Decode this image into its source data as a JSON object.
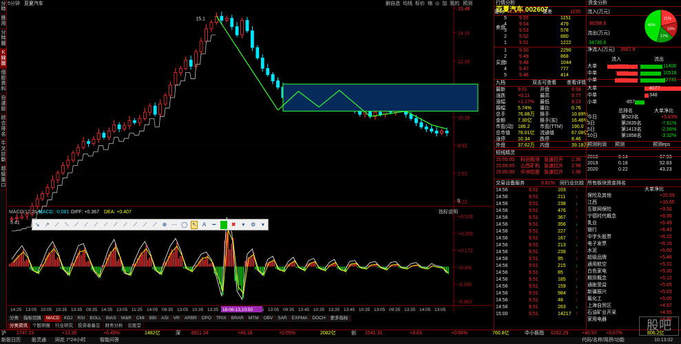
{
  "left_tabs": [
    "分時",
    "應用",
    "分時圖",
    "K線圖",
    "個股資料",
    "自選股",
    "綜合排名",
    "牛叉診斷",
    "超級盤口"
  ],
  "header": {
    "period": "5分钟",
    "name": "亚夏汽车",
    "menu": [
      "删自选",
      "均线",
      "标价",
      "缩",
      "◎",
      "加",
      "我的"
    ],
    "menu_extra": "预测"
  },
  "price_axis": [
    "15.48",
    "14.31",
    "12.95",
    "11.65",
    "10.26",
    "8.92",
    "7.57",
    "6.22"
  ],
  "annotations": {
    "high": "15.1",
    "low": "5.41",
    "marker": "q"
  },
  "macd_header": {
    "name": "MACD(12,26,9)",
    "macd_label": "MACD: -0.081",
    "diff_label": "DIFF: +0.367",
    "dea_label": "DEA: +0.407",
    "hint": "指标说明"
  },
  "macd_axis": [
    "+0.528",
    "+0.350",
    "+0.172",
    "-0.006",
    "-0.185",
    "-0.363"
  ],
  "time_axis": [
    "14:25",
    "13:05",
    "10:05",
    "10:35",
    "13:35",
    "09:35",
    "14:35",
    "13:05",
    "11:25",
    "14:05",
    "09:35",
    "13:05",
    "10:35",
    "13:35",
    "09:35",
    "14:35",
    "10:05",
    "13:05",
    "09:35",
    "13:45",
    "10:35",
    "13:35",
    "13:45",
    "10:35",
    "13:05",
    "09:35",
    "13:35",
    "14:05",
    "13:05"
  ],
  "time_highlight": "18-06-13,10:50",
  "indicator_tabs": [
    "分类",
    "指标切换",
    "MACD",
    "KDJ",
    "RSI",
    "BOLL",
    "BIAS",
    "W&R",
    "CMI",
    "BBI",
    "ASI",
    "VR",
    "ARBR",
    "DPO",
    "TRIX",
    "BRAR",
    "MTM",
    "OBV",
    "SAR",
    "EXPMA",
    "DOCH",
    "更多指标"
  ],
  "bottom_tabs": [
    "分类资讯",
    "个股研报",
    "行业研究",
    "投资者备忘",
    "财务分析",
    "论股堂"
  ],
  "status_bar": {
    "sh_label": "沪",
    "sh_index": "2747.23",
    "sh_chg": "+13.35",
    "sh_pct": "+0.49%",
    "sh_amt": "1482亿",
    "sz_label": "深",
    "sz_index": "8911.34",
    "sz_chg": "+49.16",
    "sz_pct": "+0.55%",
    "sz_amt": "2082亿",
    "cy_label": "创",
    "cy_index": "1541.31",
    "cy_chg": "+8.63",
    "cy_pct": "+0.56%",
    "zx_index": "760.8亿",
    "zx_label": "中小板指",
    "zx_val": "6162.29",
    "zx_chg": "+40.97",
    "zx_pct": "+0.67%",
    "zx_amt": "806.2亿"
  },
  "sys_bar": [
    "新股日历",
    "股灵通",
    "同花 7*24小时",
    "智能问答"
  ],
  "sys_right": [
    "代码/名称/简拼/功能",
    "10:13:02"
  ],
  "stock": {
    "tab1": "行情分析",
    "tab2": "资金分析",
    "title": "亚夏汽车 002607",
    "wb_label": "委比",
    "wb_val": "+12.01%",
    "wc_label": "委差",
    "wc_val": "1155",
    "sell_label": "卖盘",
    "buy_label": "买盘",
    "asks": [
      [
        "5",
        "9.55",
        "1151"
      ],
      [
        "4",
        "9.54",
        "479"
      ],
      [
        "3",
        "9.53",
        "578"
      ],
      [
        "2",
        "9.52",
        "880"
      ],
      [
        "1",
        "9.51",
        "1222"
      ]
    ],
    "bids": [
      [
        "1",
        "9.50",
        "2290"
      ],
      [
        "2",
        "9.49",
        "868"
      ],
      [
        "3",
        "9.48",
        "1044"
      ],
      [
        "4",
        "9.47",
        "777"
      ],
      [
        "5",
        "9.46",
        "414"
      ]
    ],
    "quote_tabs": [
      "九档",
      "双击可查看",
      "查看详情"
    ],
    "quote": [
      [
        "最新",
        "9.51",
        "开盘",
        "9.58"
      ],
      [
        "涨跌",
        "+0.11",
        "最高",
        "9.77"
      ],
      [
        "涨幅",
        "+1.17%",
        "最低",
        "9.23"
      ],
      [
        "振幅",
        "5.74%",
        "量比",
        "0.76"
      ],
      [
        "总手",
        "76.88万",
        "换手",
        "10.89%"
      ],
      [
        "金额",
        "7.30亿",
        "换手(实)",
        "16.46%"
      ],
      [
        "市盈(动)",
        "186.2",
        "市盈(TTM)",
        "190.0"
      ],
      [
        "总市值",
        "78.01亿",
        "流通值",
        "67.08亿"
      ],
      [
        "涨停",
        "10.34",
        "跌停",
        "8.46"
      ],
      [
        "外盘",
        "37.62万",
        "内盘",
        "39.18万"
      ]
    ]
  },
  "fund": {
    "in_label": "流入(万元)",
    "in_val": "38298.6",
    "out_label": "流出(万元)",
    "out_val": "34730.6",
    "net_label": "净流入(万元)",
    "net_val": "3567.9",
    "pie": [
      {
        "label": "21%",
        "value": 21,
        "color": "#ff3232"
      },
      {
        "label": "16%",
        "value": 16,
        "color": "#c01a1a"
      },
      {
        "label": "17%",
        "value": 17,
        "color": "#0a9a0a"
      },
      {
        "label": "46%",
        "value": 46,
        "color": "#00e600"
      }
    ],
    "flow_head": [
      "流入",
      "流出"
    ],
    "flows": [
      {
        "label": "大单",
        "in": "15558",
        "out": "11408"
      },
      {
        "label": "中单",
        "in": "10866",
        "out": "10518"
      },
      {
        "label": "小单",
        "in": "11874",
        "out": "12731"
      }
    ],
    "net_rows": [
      {
        "label": "大单",
        "val": "4077"
      },
      {
        "label": "中单",
        "val": "348"
      },
      {
        "label": "小单",
        "val": "-857"
      }
    ],
    "rank_head": [
      "总排名",
      "大单净比"
    ],
    "ranks": [
      [
        "今日",
        "第523名",
        "+5.83%"
      ],
      [
        "3日",
        "第2835名",
        "-7.61%"
      ],
      [
        "5日",
        "第1413名",
        "-2.56%"
      ],
      [
        "10日",
        "第1858名",
        "-3.32%"
      ]
    ]
  },
  "profit": {
    "head": [
      "预测利润",
      "预测",
      "预测eps"
    ],
    "rows": [
      [
        "2018",
        "0.14",
        "67.93"
      ],
      [
        "2019",
        "0.18",
        "52.83"
      ],
      [
        "2020",
        "0.22",
        "43.23"
      ]
    ]
  },
  "news": {
    "title": "短线精灵",
    "rows": [
      [
        "15:00:00",
        "科创板块",
        "急速拉升",
        "2.36"
      ],
      [
        "15:00:00",
        "山西矿机",
        "急速拉升",
        "2.96"
      ],
      [
        "15:00:00",
        "中洲控股",
        "急速拉升",
        "1.96"
      ]
    ]
  },
  "trades_head": [
    "交易设备服务",
    "0.81%",
    "同行业比较"
  ],
  "trades": [
    [
      "14:56",
      "9.51",
      "103"
    ],
    [
      "14:56",
      "9.51",
      "211"
    ],
    [
      "14:56",
      "9.51",
      "238"
    ],
    [
      "14:56",
      "9.51",
      "476"
    ],
    [
      "14:56",
      "9.51",
      "367"
    ],
    [
      "14:56",
      "9.51",
      "356"
    ],
    [
      "14:56",
      "9.51",
      "227"
    ],
    [
      "14:56",
      "9.51",
      "167"
    ],
    [
      "14:56",
      "9.51",
      "213"
    ],
    [
      "14:56",
      "9.51",
      "239"
    ],
    [
      "14:56",
      "9.51",
      "95"
    ],
    [
      "14:56",
      "9.51",
      "215"
    ],
    [
      "14:56",
      "9.51",
      "85"
    ],
    [
      "14:56",
      "9.51",
      "185"
    ],
    [
      "14:56",
      "9.51",
      "159"
    ],
    [
      "14:56",
      "9.51",
      "984"
    ],
    [
      "14:56",
      "9.51",
      "48"
    ],
    [
      "14:56",
      "9.51",
      "263"
    ],
    [
      "15:00",
      "9.51",
      "14217"
    ]
  ],
  "sectors_head": [
    "所有板块资金排名",
    "大单净比"
  ],
  "sectors": [
    [
      "保险及其他",
      "+10.59"
    ],
    [
      "江西",
      "+10.65"
    ],
    [
      "互联网保险",
      "+9.50"
    ],
    [
      "宁德时代概念",
      "+8.95"
    ],
    [
      "乳业",
      "+6.49"
    ],
    [
      "银行",
      "+6.43"
    ],
    [
      "中字头股票",
      "+6.22"
    ],
    [
      "电子发票",
      "+6.16"
    ],
    [
      "水泥",
      "+5.60"
    ],
    [
      "超级品牌",
      "+5.46"
    ],
    [
      "通用航空",
      "+5.31"
    ],
    [
      "白色家电",
      "+5.30"
    ],
    [
      "期货概念",
      "+5.12"
    ],
    [
      "通胀受益",
      "+5.05"
    ],
    [
      "新疆振兴",
      "+5.03"
    ],
    [
      "氟化工",
      "+5.00"
    ],
    [
      "上海自贸区",
      "+4.97"
    ],
    [
      "石油矿业开采",
      "+4.95"
    ],
    [
      "家用电器",
      "+4.86"
    ]
  ],
  "chart_data": [
    {
      "type": "candlestick",
      "title": "亚夏汽车",
      "period": "5分钟",
      "ylim": [
        6.22,
        15.48
      ],
      "yticks": [
        15.48,
        14.31,
        12.95,
        11.65,
        10.26,
        8.92,
        7.57,
        6.22
      ],
      "closes": [
        5.41,
        5.45,
        5.52,
        5.6,
        6.0,
        6.35,
        6.6,
        6.9,
        7.25,
        7.6,
        7.95,
        8.2,
        8.55,
        8.8,
        9.1,
        9.0,
        9.2,
        9.5,
        9.3,
        9.6,
        9.9,
        9.7,
        9.85,
        10.1,
        10.0,
        10.2,
        10.5,
        10.8,
        10.4,
        10.9,
        11.3,
        11.8,
        12.4,
        12.6,
        13.0,
        12.7,
        13.4,
        13.9,
        14.5,
        14.8,
        15.1,
        14.9,
        15.0,
        14.6,
        14.2,
        14.9,
        14.4,
        13.6,
        13.1,
        12.6,
        12.3,
        12.0,
        11.7,
        11.2,
        10.8,
        11.5,
        11.0,
        10.9,
        11.2,
        11.0,
        10.8,
        11.3,
        11.1,
        11.0,
        11.5,
        11.2,
        10.9,
        10.6,
        10.4,
        10.7,
        10.3,
        10.5,
        10.4,
        10.6,
        10.5,
        10.8,
        10.6,
        10.4,
        10.2,
        10.0,
        9.8,
        9.7,
        9.6,
        9.5,
        9.6,
        9.51
      ],
      "trend_lines": [
        {
          "from": [
            15.1,
            15.1
          ],
          "to": [
            11.3,
            11.3
          ]
        },
        {
          "name": "channel",
          "low": 10.3,
          "high": 11.8
        }
      ],
      "annotations": [
        "15.1",
        "5.41"
      ]
    },
    {
      "type": "bar",
      "title": "MACD(12,26,9)",
      "ylim": [
        -0.363,
        0.528
      ],
      "yticks": [
        0.528,
        0.35,
        0.172,
        -0.006,
        -0.185,
        -0.363
      ],
      "macd": -0.081,
      "diff": 0.367,
      "dea": 0.407,
      "histogram": [
        0.05,
        0.12,
        0.18,
        0.1,
        -0.05,
        -0.08,
        0.03,
        0.15,
        0.22,
        0.12,
        -0.04,
        -0.1,
        0.05,
        0.18,
        0.2,
        0.08,
        -0.06,
        -0.12,
        0.02,
        0.16,
        0.24,
        0.1,
        -0.08,
        -0.1,
        0.04,
        0.15,
        0.22,
        0.12,
        -0.05,
        -0.09,
        0.06,
        0.18,
        0.25,
        0.14,
        -0.03,
        -0.06,
        0.02,
        0.1,
        0.12,
        0.05,
        -0.12,
        -0.3,
        0.45,
        0.3,
        -0.25,
        -0.33,
        0.1,
        0.15,
        -0.05,
        -0.1,
        0.05,
        0.08,
        -0.04,
        -0.06,
        0.03,
        0.07,
        -0.02,
        -0.05,
        0.04,
        0.06,
        -0.03,
        -0.05,
        0.02,
        0.05,
        -0.04,
        -0.06,
        0.03,
        0.04,
        -0.02,
        -0.03,
        0.02,
        0.03,
        -0.02,
        -0.04,
        0.02,
        0.03,
        -0.02,
        -0.03,
        0.01,
        0.02,
        -0.02,
        -0.03,
        0.01,
        -0.01,
        -0.02,
        -0.08
      ]
    },
    {
      "type": "pie",
      "labels": [
        "21%",
        "16%",
        "17%",
        "46%"
      ],
      "values": [
        21,
        16,
        17,
        46
      ]
    }
  ]
}
